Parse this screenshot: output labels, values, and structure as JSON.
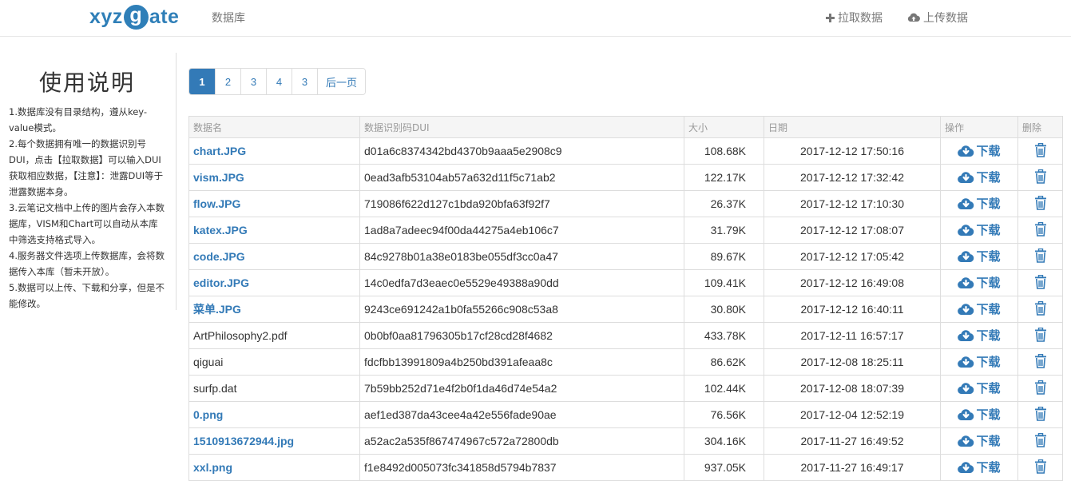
{
  "nav": {
    "logo_left": "xyz",
    "logo_g": "g",
    "logo_right": "ate",
    "database": "数据库",
    "pull": "拉取数据",
    "upload": "上传数据"
  },
  "sidebar": {
    "title": "使用说明",
    "items": [
      "1.数据库没有目录结构，遵从key-value模式。",
      "2.每个数据拥有唯一的数据识别号DUI，点击【拉取数据】可以输入DUI获取相应数据，【注意】：泄露DUI等于泄露数据本身。",
      "3.云笔记文档中上传的图片会存入本数据库，VISM和Chart可以自动从本库中筛选支持格式导入。",
      "4.服务器文件选项上传数据库，会将数据传入本库（暂未开放）。",
      "5.数据可以上传、下载和分享，但是不能修改。"
    ]
  },
  "pagination": {
    "pages": [
      "1",
      "2",
      "3",
      "4",
      "3"
    ],
    "next": "后一页",
    "active": "1"
  },
  "table": {
    "headers": {
      "name": "数据名",
      "dui": "数据识别码DUI",
      "size": "大小",
      "date": "日期",
      "op": "操作",
      "del": "删除"
    },
    "download_label": "下载",
    "rows": [
      {
        "name": "chart.JPG",
        "link": true,
        "dui": "d01a6c8374342bd4370b9aaa5e2908c9",
        "size": "108.68K",
        "date": "2017-12-12 17:50:16"
      },
      {
        "name": "vism.JPG",
        "link": true,
        "dui": "0ead3afb53104ab57a632d11f5c71ab2",
        "size": "122.17K",
        "date": "2017-12-12 17:32:42"
      },
      {
        "name": "flow.JPG",
        "link": true,
        "dui": "719086f622d127c1bda920bfa63f92f7",
        "size": "26.37K",
        "date": "2017-12-12 17:10:30"
      },
      {
        "name": "katex.JPG",
        "link": true,
        "dui": "1ad8a7adeec94f00da44275a4eb106c7",
        "size": "31.79K",
        "date": "2017-12-12 17:08:07"
      },
      {
        "name": "code.JPG",
        "link": true,
        "dui": "84c9278b01a38e0183be055df3cc0a47",
        "size": "89.67K",
        "date": "2017-12-12 17:05:42"
      },
      {
        "name": "editor.JPG",
        "link": true,
        "dui": "14c0edfa7d3eaec0e5529e49388a90dd",
        "size": "109.41K",
        "date": "2017-12-12 16:49:08"
      },
      {
        "name": "菜单.JPG",
        "link": true,
        "dui": "9243ce691242a1b0fa55266c908c53a8",
        "size": "30.80K",
        "date": "2017-12-12 16:40:11"
      },
      {
        "name": "ArtPhilosophy2.pdf",
        "link": false,
        "dui": "0b0bf0aa81796305b17cf28cd28f4682",
        "size": "433.78K",
        "date": "2017-12-11 16:57:17"
      },
      {
        "name": "qiguai",
        "link": false,
        "dui": "fdcfbb13991809a4b250bd391afeaa8c",
        "size": "86.62K",
        "date": "2017-12-08 18:25:11"
      },
      {
        "name": "surfp.dat",
        "link": false,
        "dui": "7b59bb252d71e4f2b0f1da46d74e54a2",
        "size": "102.44K",
        "date": "2017-12-08 18:07:39"
      },
      {
        "name": "0.png",
        "link": true,
        "dui": "aef1ed387da43cee4a42e556fade90ae",
        "size": "76.56K",
        "date": "2017-12-04 12:52:19"
      },
      {
        "name": "1510913672944.jpg",
        "link": true,
        "dui": "a52ac2a535f867474967c572a72800db",
        "size": "304.16K",
        "date": "2017-11-27 16:49:52"
      },
      {
        "name": "xxl.png",
        "link": true,
        "dui": "f1e8492d005073fc341858d5794b7837",
        "size": "937.05K",
        "date": "2017-11-27 16:49:17"
      }
    ]
  },
  "colors": {
    "accent": "#337ab7",
    "border": "#dddddd",
    "header_bg": "#f5f5f5"
  }
}
